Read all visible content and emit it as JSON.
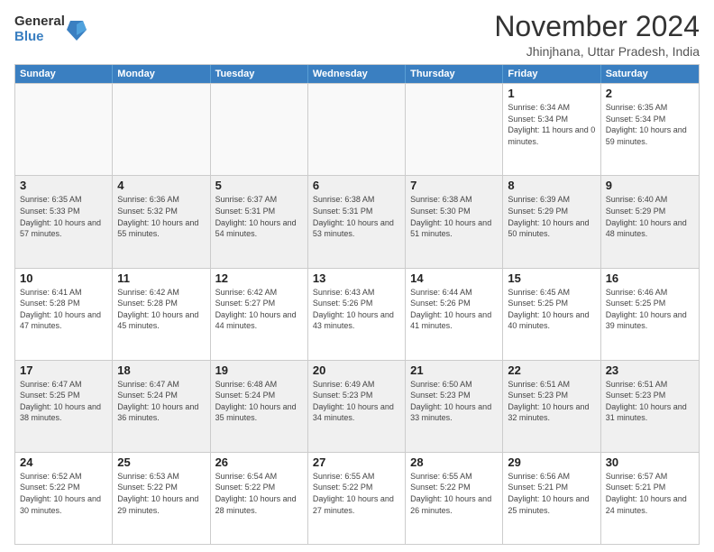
{
  "logo": {
    "general": "General",
    "blue": "Blue"
  },
  "title": "November 2024",
  "subtitle": "Jhinjhana, Uttar Pradesh, India",
  "days_of_week": [
    "Sunday",
    "Monday",
    "Tuesday",
    "Wednesday",
    "Thursday",
    "Friday",
    "Saturday"
  ],
  "weeks": [
    [
      {
        "day": "",
        "info": ""
      },
      {
        "day": "",
        "info": ""
      },
      {
        "day": "",
        "info": ""
      },
      {
        "day": "",
        "info": ""
      },
      {
        "day": "",
        "info": ""
      },
      {
        "day": "1",
        "info": "Sunrise: 6:34 AM\nSunset: 5:34 PM\nDaylight: 11 hours and 0 minutes."
      },
      {
        "day": "2",
        "info": "Sunrise: 6:35 AM\nSunset: 5:34 PM\nDaylight: 10 hours and 59 minutes."
      }
    ],
    [
      {
        "day": "3",
        "info": "Sunrise: 6:35 AM\nSunset: 5:33 PM\nDaylight: 10 hours and 57 minutes."
      },
      {
        "day": "4",
        "info": "Sunrise: 6:36 AM\nSunset: 5:32 PM\nDaylight: 10 hours and 55 minutes."
      },
      {
        "day": "5",
        "info": "Sunrise: 6:37 AM\nSunset: 5:31 PM\nDaylight: 10 hours and 54 minutes."
      },
      {
        "day": "6",
        "info": "Sunrise: 6:38 AM\nSunset: 5:31 PM\nDaylight: 10 hours and 53 minutes."
      },
      {
        "day": "7",
        "info": "Sunrise: 6:38 AM\nSunset: 5:30 PM\nDaylight: 10 hours and 51 minutes."
      },
      {
        "day": "8",
        "info": "Sunrise: 6:39 AM\nSunset: 5:29 PM\nDaylight: 10 hours and 50 minutes."
      },
      {
        "day": "9",
        "info": "Sunrise: 6:40 AM\nSunset: 5:29 PM\nDaylight: 10 hours and 48 minutes."
      }
    ],
    [
      {
        "day": "10",
        "info": "Sunrise: 6:41 AM\nSunset: 5:28 PM\nDaylight: 10 hours and 47 minutes."
      },
      {
        "day": "11",
        "info": "Sunrise: 6:42 AM\nSunset: 5:28 PM\nDaylight: 10 hours and 45 minutes."
      },
      {
        "day": "12",
        "info": "Sunrise: 6:42 AM\nSunset: 5:27 PM\nDaylight: 10 hours and 44 minutes."
      },
      {
        "day": "13",
        "info": "Sunrise: 6:43 AM\nSunset: 5:26 PM\nDaylight: 10 hours and 43 minutes."
      },
      {
        "day": "14",
        "info": "Sunrise: 6:44 AM\nSunset: 5:26 PM\nDaylight: 10 hours and 41 minutes."
      },
      {
        "day": "15",
        "info": "Sunrise: 6:45 AM\nSunset: 5:25 PM\nDaylight: 10 hours and 40 minutes."
      },
      {
        "day": "16",
        "info": "Sunrise: 6:46 AM\nSunset: 5:25 PM\nDaylight: 10 hours and 39 minutes."
      }
    ],
    [
      {
        "day": "17",
        "info": "Sunrise: 6:47 AM\nSunset: 5:25 PM\nDaylight: 10 hours and 38 minutes."
      },
      {
        "day": "18",
        "info": "Sunrise: 6:47 AM\nSunset: 5:24 PM\nDaylight: 10 hours and 36 minutes."
      },
      {
        "day": "19",
        "info": "Sunrise: 6:48 AM\nSunset: 5:24 PM\nDaylight: 10 hours and 35 minutes."
      },
      {
        "day": "20",
        "info": "Sunrise: 6:49 AM\nSunset: 5:23 PM\nDaylight: 10 hours and 34 minutes."
      },
      {
        "day": "21",
        "info": "Sunrise: 6:50 AM\nSunset: 5:23 PM\nDaylight: 10 hours and 33 minutes."
      },
      {
        "day": "22",
        "info": "Sunrise: 6:51 AM\nSunset: 5:23 PM\nDaylight: 10 hours and 32 minutes."
      },
      {
        "day": "23",
        "info": "Sunrise: 6:51 AM\nSunset: 5:23 PM\nDaylight: 10 hours and 31 minutes."
      }
    ],
    [
      {
        "day": "24",
        "info": "Sunrise: 6:52 AM\nSunset: 5:22 PM\nDaylight: 10 hours and 30 minutes."
      },
      {
        "day": "25",
        "info": "Sunrise: 6:53 AM\nSunset: 5:22 PM\nDaylight: 10 hours and 29 minutes."
      },
      {
        "day": "26",
        "info": "Sunrise: 6:54 AM\nSunset: 5:22 PM\nDaylight: 10 hours and 28 minutes."
      },
      {
        "day": "27",
        "info": "Sunrise: 6:55 AM\nSunset: 5:22 PM\nDaylight: 10 hours and 27 minutes."
      },
      {
        "day": "28",
        "info": "Sunrise: 6:55 AM\nSunset: 5:22 PM\nDaylight: 10 hours and 26 minutes."
      },
      {
        "day": "29",
        "info": "Sunrise: 6:56 AM\nSunset: 5:21 PM\nDaylight: 10 hours and 25 minutes."
      },
      {
        "day": "30",
        "info": "Sunrise: 6:57 AM\nSunset: 5:21 PM\nDaylight: 10 hours and 24 minutes."
      }
    ]
  ],
  "shaded_rows": [
    1,
    3
  ],
  "empty_cells": {
    "0": [
      0,
      1,
      2,
      3,
      4
    ]
  }
}
